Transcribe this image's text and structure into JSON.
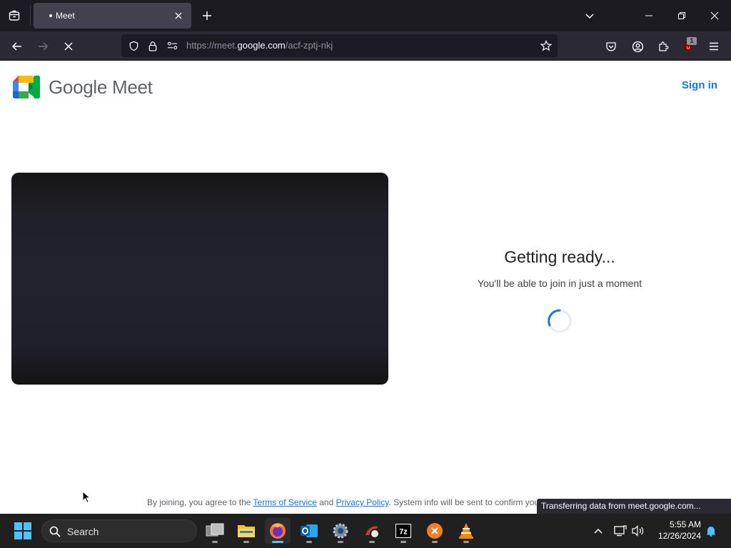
{
  "browser": {
    "tab": {
      "title": "Meet"
    },
    "url": {
      "prefix": "https://meet.",
      "host": "google.com",
      "path": "/acf-zptj-nkj"
    },
    "extension_badge": "1"
  },
  "page": {
    "brand": "Google Meet",
    "sign_in": "Sign in",
    "ready_title": "Getting ready...",
    "ready_subtitle": "You'll be able to join in just a moment",
    "footer": {
      "prefix": "By joining, you agree to the ",
      "terms": "Terms of Service",
      "and": " and ",
      "privacy": "Privacy Policy",
      "suffix": ". System info will be sent to confirm you"
    },
    "status_text": "Transferring data from meet.google.com..."
  },
  "taskbar": {
    "search_label": "Search",
    "apps": [
      "task-view",
      "file-explorer",
      "firefox",
      "outlook",
      "settings",
      "ccleaner",
      "7zip",
      "xampp",
      "vlc"
    ],
    "time": "5:55 AM",
    "date": "12/26/2024"
  },
  "colors": {
    "accent_blue": "#1a73e8",
    "chrome_dark": "#1c1b22",
    "taskbar": "#202020"
  }
}
